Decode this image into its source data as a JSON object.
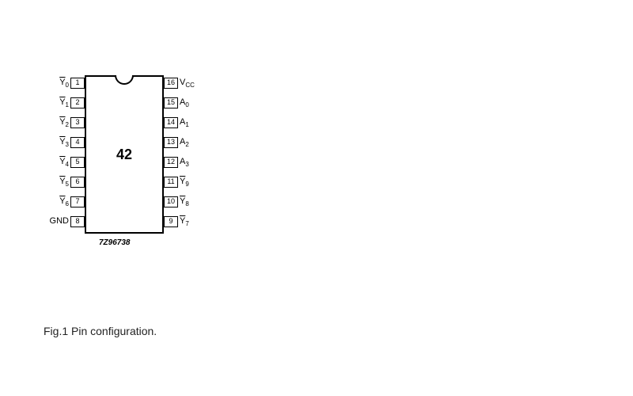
{
  "chip": {
    "center_label": "42",
    "part_code": "7Z96738"
  },
  "pins_left": [
    {
      "num": "1",
      "label_html": "<span class='overline'>Y</span><sub>0</sub>"
    },
    {
      "num": "2",
      "label_html": "<span class='overline'>Y</span><sub>1</sub>"
    },
    {
      "num": "3",
      "label_html": "<span class='overline'>Y</span><sub>2</sub>"
    },
    {
      "num": "4",
      "label_html": "<span class='overline'>Y</span><sub>3</sub>"
    },
    {
      "num": "5",
      "label_html": "<span class='overline'>Y</span><sub>4</sub>"
    },
    {
      "num": "6",
      "label_html": "<span class='overline'>Y</span><sub>5</sub>"
    },
    {
      "num": "7",
      "label_html": "<span class='overline'>Y</span><sub>6</sub>"
    },
    {
      "num": "8",
      "label_html": "GND"
    }
  ],
  "pins_right": [
    {
      "num": "16",
      "label_html": "V<sub>CC</sub>"
    },
    {
      "num": "15",
      "label_html": "A<sub>0</sub>"
    },
    {
      "num": "14",
      "label_html": "A<sub>1</sub>"
    },
    {
      "num": "13",
      "label_html": "A<sub>2</sub>"
    },
    {
      "num": "12",
      "label_html": "A<sub>3</sub>"
    },
    {
      "num": "11",
      "label_html": "<span class='overline'>Y</span><sub>9</sub>"
    },
    {
      "num": "10",
      "label_html": "<span class='overline'>Y</span><sub>8</sub>"
    },
    {
      "num": "9",
      "label_html": "<span class='overline'>Y</span><sub>7</sub>"
    }
  ],
  "caption": "Fig.1  Pin configuration."
}
